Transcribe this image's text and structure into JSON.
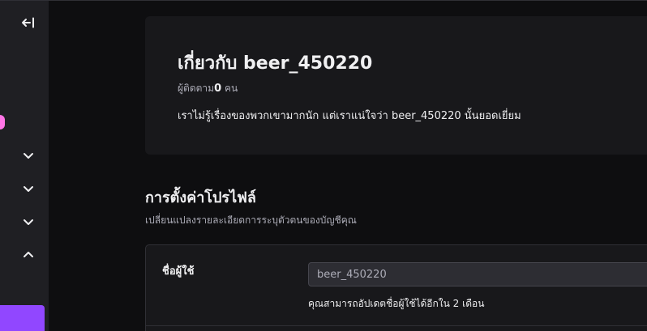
{
  "sidebar": {
    "collapse_icon": "collapse-left-icon",
    "chevrons": [
      "chevron-down-icon",
      "chevron-down-icon",
      "chevron-down-icon",
      "chevron-up-icon"
    ],
    "accent_dot_color": "#ff75e6",
    "primary_button_color": "#9147ff"
  },
  "about": {
    "title": "เกี่ยวกับ beer_450220",
    "followers_label": "ผู้ติดตาม",
    "followers_count": "0",
    "followers_unit": "คน",
    "description": "เราไม่รู้เรื่องของพวกเขามากนัก แต่เราแน่ใจว่า beer_450220 นั้นยอดเยี่ยม"
  },
  "profile_settings": {
    "title": "การตั้งค่าโปรไฟล์",
    "subtitle": "เปลี่ยนแปลงรายละเอียดการระบุตัวตนของบัญชีคุณ",
    "username": {
      "label": "ชื่อผู้ใช้",
      "value": "beer_450220",
      "help": "คุณสามารถอัปเดตชื่อผู้ใช้ได้อีกใน 2 เดือน"
    }
  }
}
